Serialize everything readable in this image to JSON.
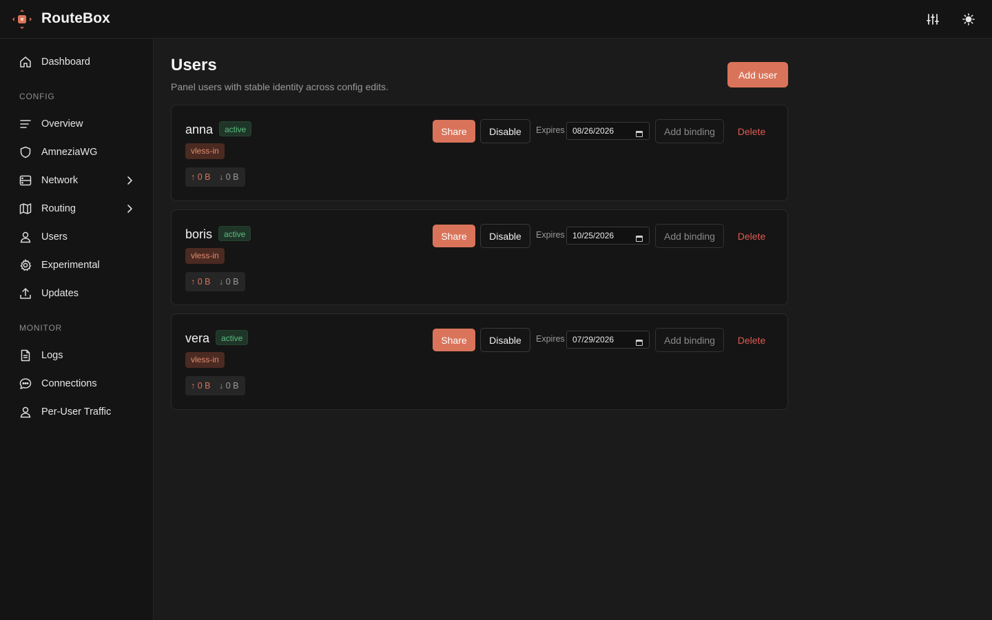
{
  "app": {
    "name": "RouteBox"
  },
  "header": {
    "filters_icon": "sliders-icon",
    "theme_icon": "sun-icon"
  },
  "sidebar": {
    "dashboard": {
      "label": "Dashboard",
      "icon": "home-icon"
    },
    "sections": [
      {
        "title": "CONFIG",
        "items": [
          {
            "label": "Overview",
            "icon": "lines-icon"
          },
          {
            "label": "AmneziaWG",
            "icon": "shield-icon"
          },
          {
            "label": "Network",
            "icon": "server-icon",
            "expandable": true
          },
          {
            "label": "Routing",
            "icon": "map-icon",
            "expandable": true
          },
          {
            "label": "Users",
            "icon": "user-icon"
          },
          {
            "label": "Experimental",
            "icon": "gear-icon"
          },
          {
            "label": "Updates",
            "icon": "upload-icon"
          }
        ]
      },
      {
        "title": "MONITOR",
        "items": [
          {
            "label": "Logs",
            "icon": "file-icon"
          },
          {
            "label": "Connections",
            "icon": "chat-icon"
          },
          {
            "label": "Per-User Traffic",
            "icon": "user-icon"
          }
        ]
      }
    ]
  },
  "page": {
    "title": "Users",
    "subtitle": "Panel users with stable identity across config edits.",
    "add_button": "Add user"
  },
  "actions": {
    "share": "Share",
    "disable": "Disable",
    "expires": "Expires",
    "add_binding": "Add binding",
    "delete": "Delete"
  },
  "users": [
    {
      "name": "anna",
      "status": "active",
      "binding": "vless-in",
      "up": "↑ 0 B",
      "down": "↓ 0 B",
      "expires": "08/26/2026"
    },
    {
      "name": "boris",
      "status": "active",
      "binding": "vless-in",
      "up": "↑ 0 B",
      "down": "↓ 0 B",
      "expires": "10/25/2026"
    },
    {
      "name": "vera",
      "status": "active",
      "binding": "vless-in",
      "up": "↑ 0 B",
      "down": "↓ 0 B",
      "expires": "07/29/2026"
    }
  ],
  "colors": {
    "accent": "#d9745a",
    "danger": "#e05b52",
    "success": "#5dbb82",
    "background": "#1b1b1b",
    "surface": "#151515"
  }
}
